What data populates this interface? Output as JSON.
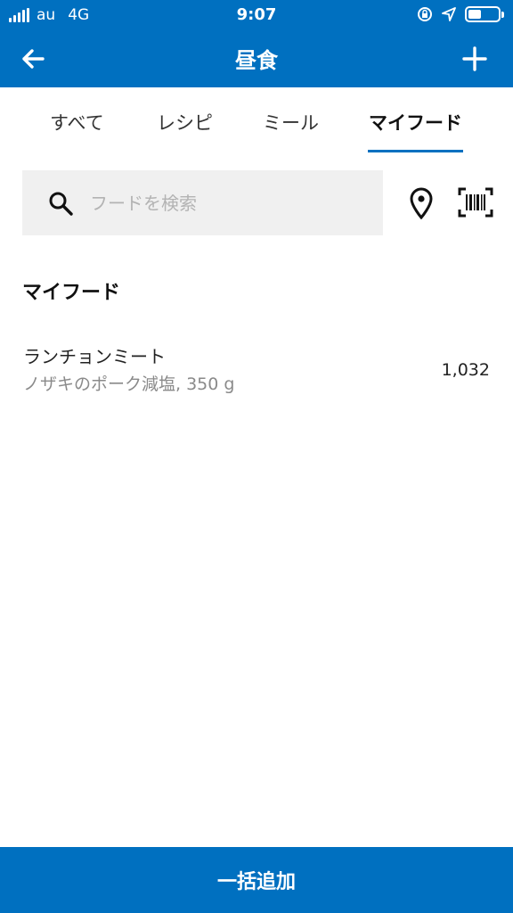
{
  "status_bar": {
    "carrier": "au",
    "network": "4G",
    "time": "9:07",
    "battery_level": 0.45,
    "icons": [
      "signal-bars",
      "orientation-lock-icon",
      "location-arrow-icon",
      "battery-icon"
    ]
  },
  "header": {
    "title": "昼食",
    "back_icon": "arrow-left-icon",
    "add_icon": "plus-icon"
  },
  "tabs": [
    {
      "label": "すべて",
      "active": false
    },
    {
      "label": "レシピ",
      "active": false
    },
    {
      "label": "ミール",
      "active": false
    },
    {
      "label": "マイフード",
      "active": true
    }
  ],
  "search": {
    "placeholder": "フードを検索",
    "value": "",
    "search_icon": "search-icon",
    "location_icon": "map-pin-icon",
    "barcode_icon": "barcode-scan-icon"
  },
  "section": {
    "title": "マイフード"
  },
  "foods": [
    {
      "name": "ランチョンミート",
      "description": "ノザキのポーク減塩, 350 g",
      "calories": "1,032"
    }
  ],
  "footer": {
    "bulk_add_label": "一括追加"
  },
  "colors": {
    "primary": "#0070c0",
    "search_bg": "#f0f0f0",
    "secondary_text": "#8a8a8a"
  }
}
